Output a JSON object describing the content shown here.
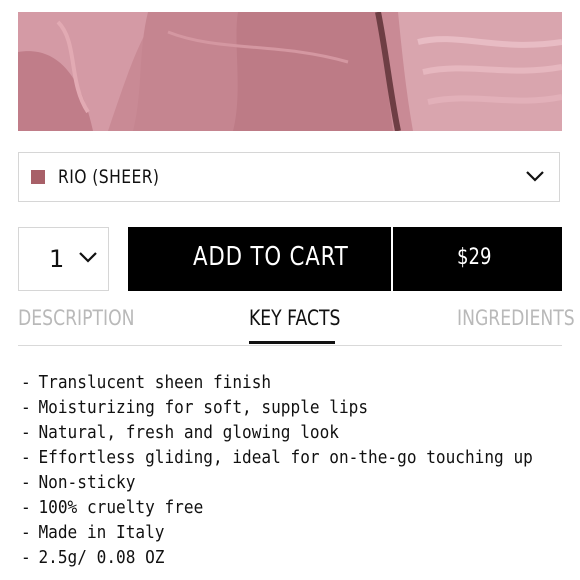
{
  "hero": {
    "image": "lipstick-texture-swatch"
  },
  "shade": {
    "name": "RIO (SHEER)",
    "swatch_color": "#a86068"
  },
  "quantity": {
    "value": "1"
  },
  "cart": {
    "label": "ADD TO CART",
    "price": "$29"
  },
  "tabs": [
    {
      "label": "DESCRIPTION",
      "active": false
    },
    {
      "label": "KEY FACTS",
      "active": true
    },
    {
      "label": "INGREDIENTS",
      "active": false
    }
  ],
  "key_facts": [
    "Translucent sheen finish",
    "Moisturizing for soft, supple lips",
    "Natural, fresh and glowing look",
    "Effortless gliding, ideal for on-the-go touching up",
    "Non-sticky",
    "100% cruelty free",
    "Made in Italy",
    "2.5g/ 0.08 OZ"
  ],
  "colors": {
    "accent": "#000000",
    "inactive_tab": "#b9b9b9",
    "border": "#d6d6d6"
  }
}
